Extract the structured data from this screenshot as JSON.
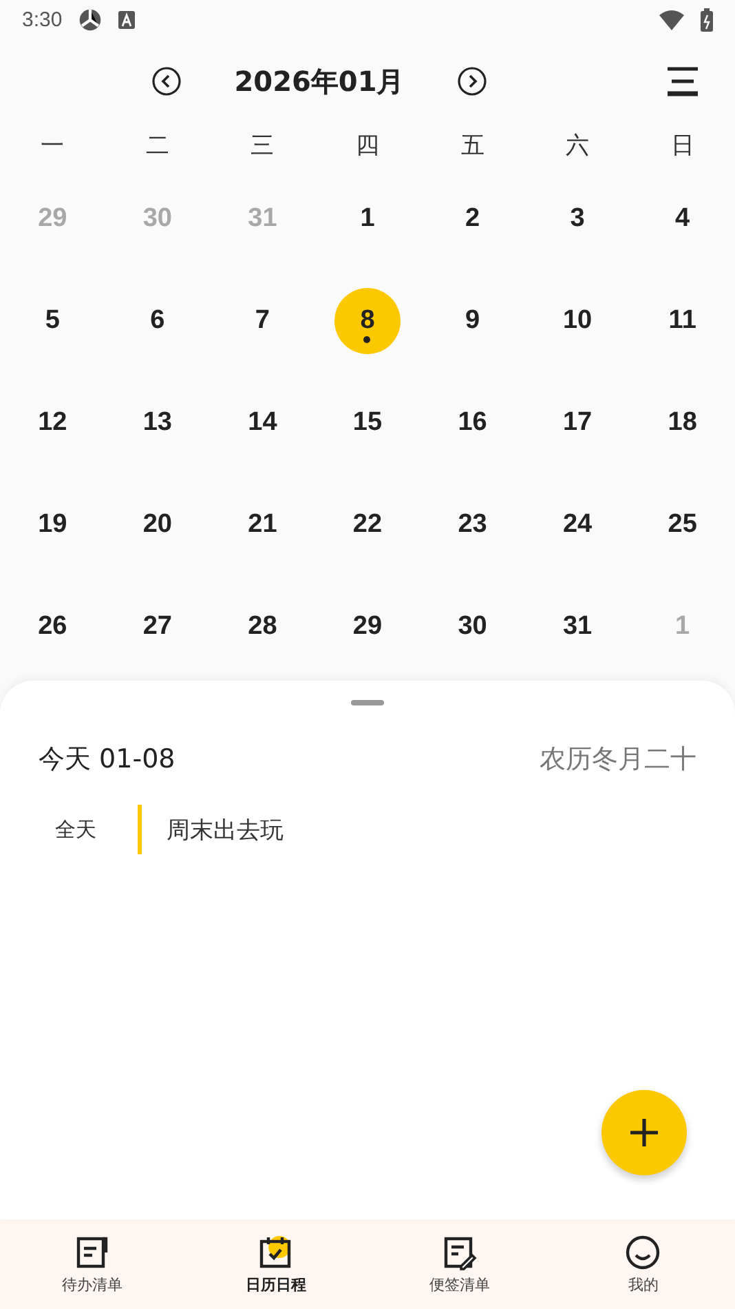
{
  "status_bar": {
    "time": "3:30"
  },
  "header": {
    "title": "2026年01月"
  },
  "weekdays": [
    "一",
    "二",
    "三",
    "四",
    "五",
    "六",
    "日"
  ],
  "weeks": [
    [
      {
        "day": "29",
        "muted": true,
        "selected": false,
        "has_event": false
      },
      {
        "day": "30",
        "muted": true,
        "selected": false,
        "has_event": false
      },
      {
        "day": "31",
        "muted": true,
        "selected": false,
        "has_event": false
      },
      {
        "day": "1",
        "muted": false,
        "selected": false,
        "has_event": false
      },
      {
        "day": "2",
        "muted": false,
        "selected": false,
        "has_event": false
      },
      {
        "day": "3",
        "muted": false,
        "selected": false,
        "has_event": false
      },
      {
        "day": "4",
        "muted": false,
        "selected": false,
        "has_event": false
      }
    ],
    [
      {
        "day": "5",
        "muted": false,
        "selected": false,
        "has_event": false
      },
      {
        "day": "6",
        "muted": false,
        "selected": false,
        "has_event": false
      },
      {
        "day": "7",
        "muted": false,
        "selected": false,
        "has_event": false
      },
      {
        "day": "8",
        "muted": false,
        "selected": true,
        "has_event": true
      },
      {
        "day": "9",
        "muted": false,
        "selected": false,
        "has_event": false
      },
      {
        "day": "10",
        "muted": false,
        "selected": false,
        "has_event": false
      },
      {
        "day": "11",
        "muted": false,
        "selected": false,
        "has_event": false
      }
    ],
    [
      {
        "day": "12",
        "muted": false,
        "selected": false,
        "has_event": false
      },
      {
        "day": "13",
        "muted": false,
        "selected": false,
        "has_event": false
      },
      {
        "day": "14",
        "muted": false,
        "selected": false,
        "has_event": false
      },
      {
        "day": "15",
        "muted": false,
        "selected": false,
        "has_event": false
      },
      {
        "day": "16",
        "muted": false,
        "selected": false,
        "has_event": false
      },
      {
        "day": "17",
        "muted": false,
        "selected": false,
        "has_event": false
      },
      {
        "day": "18",
        "muted": false,
        "selected": false,
        "has_event": false
      }
    ],
    [
      {
        "day": "19",
        "muted": false,
        "selected": false,
        "has_event": false
      },
      {
        "day": "20",
        "muted": false,
        "selected": false,
        "has_event": false
      },
      {
        "day": "21",
        "muted": false,
        "selected": false,
        "has_event": false
      },
      {
        "day": "22",
        "muted": false,
        "selected": false,
        "has_event": false
      },
      {
        "day": "23",
        "muted": false,
        "selected": false,
        "has_event": false
      },
      {
        "day": "24",
        "muted": false,
        "selected": false,
        "has_event": false
      },
      {
        "day": "25",
        "muted": false,
        "selected": false,
        "has_event": false
      }
    ],
    [
      {
        "day": "26",
        "muted": false,
        "selected": false,
        "has_event": false
      },
      {
        "day": "27",
        "muted": false,
        "selected": false,
        "has_event": false
      },
      {
        "day": "28",
        "muted": false,
        "selected": false,
        "has_event": false
      },
      {
        "day": "29",
        "muted": false,
        "selected": false,
        "has_event": false
      },
      {
        "day": "30",
        "muted": false,
        "selected": false,
        "has_event": false
      },
      {
        "day": "31",
        "muted": false,
        "selected": false,
        "has_event": false
      },
      {
        "day": "1",
        "muted": true,
        "selected": false,
        "has_event": false
      }
    ]
  ],
  "sheet": {
    "date": "今天 01-08",
    "lunar": "农历冬月二十",
    "events": [
      {
        "time": "全天",
        "title": "周末出去玩"
      }
    ]
  },
  "nav": [
    {
      "label": "待办清单",
      "kind": "todo",
      "selected": false
    },
    {
      "label": "日历日程",
      "kind": "calendar",
      "selected": true
    },
    {
      "label": "便签清单",
      "kind": "note",
      "selected": false
    },
    {
      "label": "我的",
      "kind": "profile",
      "selected": false
    }
  ]
}
